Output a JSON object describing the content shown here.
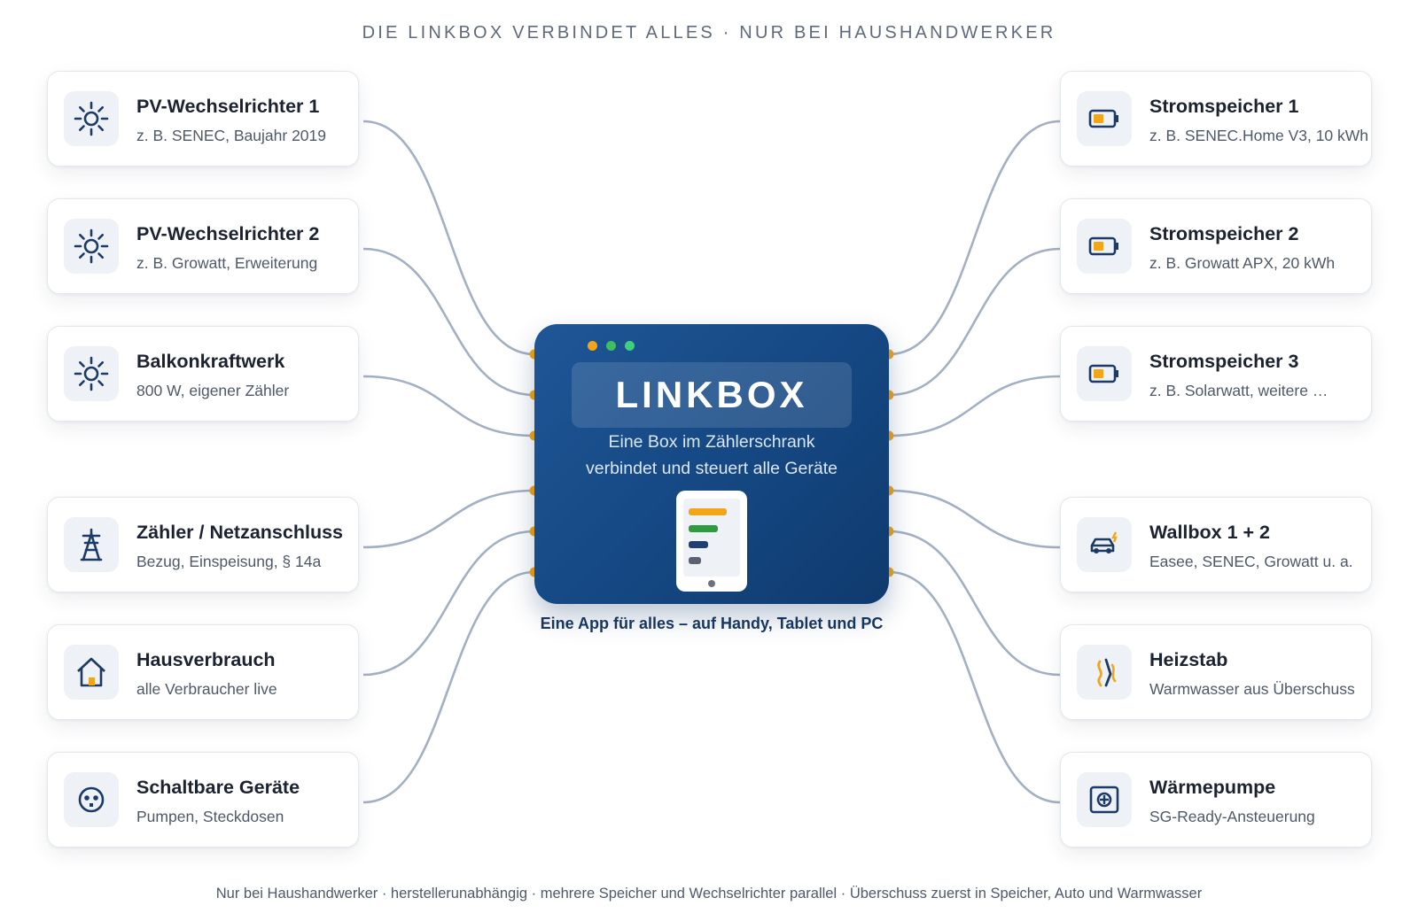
{
  "header": {
    "title": "DIE LINKBOX VERBINDET ALLES · NUR BEI HAUSHANDWERKER"
  },
  "hub": {
    "name": "LINKBOX",
    "description_line1": "Eine Box im Zählerschrank",
    "description_line2": "verbindet und steuert alle Geräte",
    "caption": "Eine App für alles – auf Handy, Tablet und PC",
    "window_dots": [
      "#f2a516",
      "#3fbf5f",
      "#3fd17a"
    ],
    "app_bar_colors": [
      "#f2a516",
      "#2e9b3e",
      "#1f3f72",
      "#5b6270"
    ]
  },
  "left_devices": [
    {
      "title": "PV-Wechselrichter 1",
      "subtitle": "z. B. SENEC, Baujahr 2019",
      "icon": "sun-icon"
    },
    {
      "title": "PV-Wechselrichter 2",
      "subtitle": "z. B. Growatt, Erweiterung",
      "icon": "sun-icon"
    },
    {
      "title": "Balkonkraftwerk",
      "subtitle": "800 W, eigener Zähler",
      "icon": "sun-icon"
    },
    {
      "title": "Zähler / Netzanschluss",
      "subtitle": "Bezug, Einspeisung, § 14a",
      "icon": "power-pylon-icon"
    },
    {
      "title": "Hausverbrauch",
      "subtitle": "alle Verbraucher live",
      "icon": "house-icon"
    },
    {
      "title": "Schaltbare Geräte",
      "subtitle": "Pumpen, Steckdosen",
      "icon": "socket-icon"
    }
  ],
  "right_devices": [
    {
      "title": "Stromspeicher 1",
      "subtitle": "z. B. SENEC.Home V3, 10 kWh",
      "icon": "battery-icon"
    },
    {
      "title": "Stromspeicher 2",
      "subtitle": "z. B. Growatt APX, 20 kWh",
      "icon": "battery-icon"
    },
    {
      "title": "Stromspeicher 3",
      "subtitle": "z. B. Solarwatt, weitere …",
      "icon": "battery-icon"
    },
    {
      "title": "Wallbox 1 + 2",
      "subtitle": "Easee, SENEC, Growatt u. a.",
      "icon": "car-charging-icon"
    },
    {
      "title": "Heizstab",
      "subtitle": "Warmwasser aus Überschuss",
      "icon": "heating-rod-icon"
    },
    {
      "title": "Wärmepumpe",
      "subtitle": "SG-Ready-Ansteuerung",
      "icon": "heat-pump-icon"
    }
  ],
  "footer": {
    "text": "Nur bei Haushandwerker · herstellerunabhängig · mehrere Speicher und Wechselrichter parallel · Überschuss zuerst in Speicher, Auto und Warmwasser"
  },
  "colors": {
    "navy": "#1b3a66",
    "accent": "#f2a516",
    "wire": "#a3b0c2",
    "hub": "#164a86"
  }
}
